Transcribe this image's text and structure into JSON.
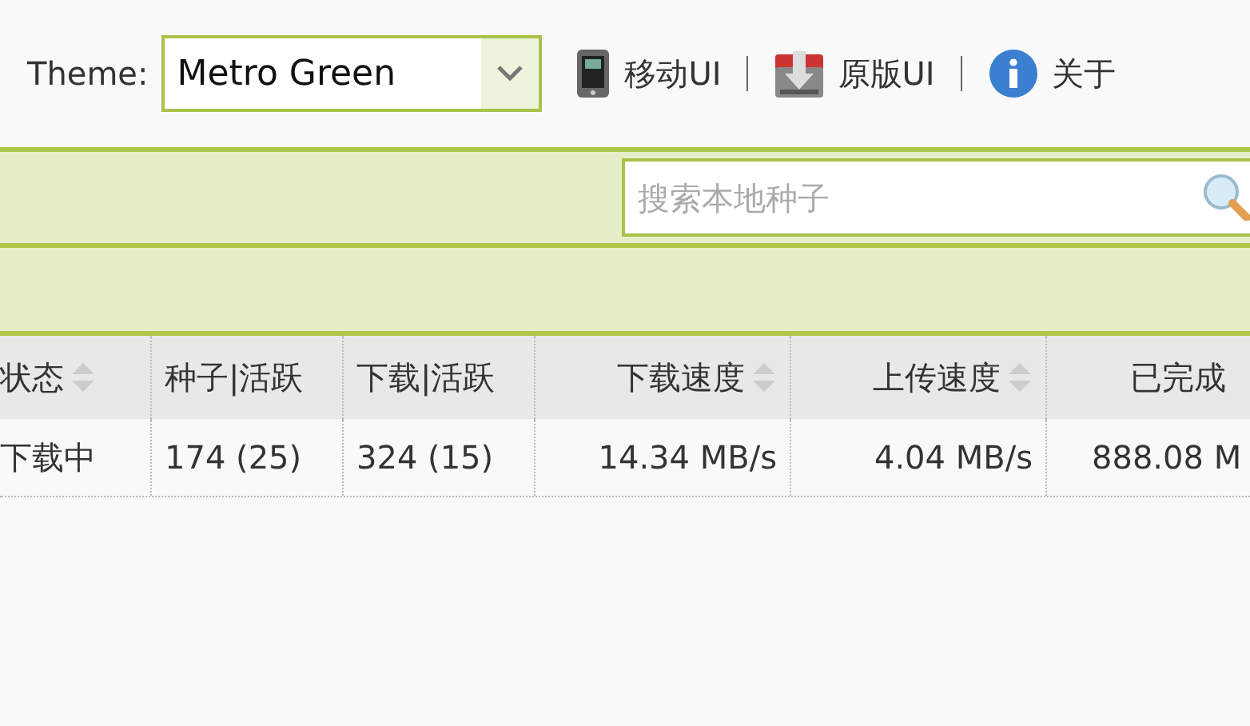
{
  "theme": {
    "label": "Theme:",
    "value": "Metro Green"
  },
  "links": [
    {
      "kind": "phone",
      "label": "移动UI"
    },
    {
      "kind": "download",
      "label": "原版UI"
    },
    {
      "kind": "info",
      "label": "关于"
    }
  ],
  "search": {
    "placeholder": "搜索本地种子"
  },
  "table": {
    "columns": [
      {
        "label": "状态",
        "sortable": true,
        "kind": "text"
      },
      {
        "label": "种子|活跃",
        "sortable": false,
        "kind": "text"
      },
      {
        "label": "下载|活跃",
        "sortable": false,
        "kind": "text"
      },
      {
        "label": "下载速度",
        "sortable": true,
        "kind": "number"
      },
      {
        "label": "上传速度",
        "sortable": true,
        "kind": "number"
      },
      {
        "label": "已完成",
        "sortable": false,
        "kind": "number"
      }
    ],
    "rows": [
      [
        "下载中",
        "174 (25)",
        "324 (15)",
        "14.34 MB/s",
        "4.04 MB/s",
        "888.08 M"
      ]
    ]
  }
}
